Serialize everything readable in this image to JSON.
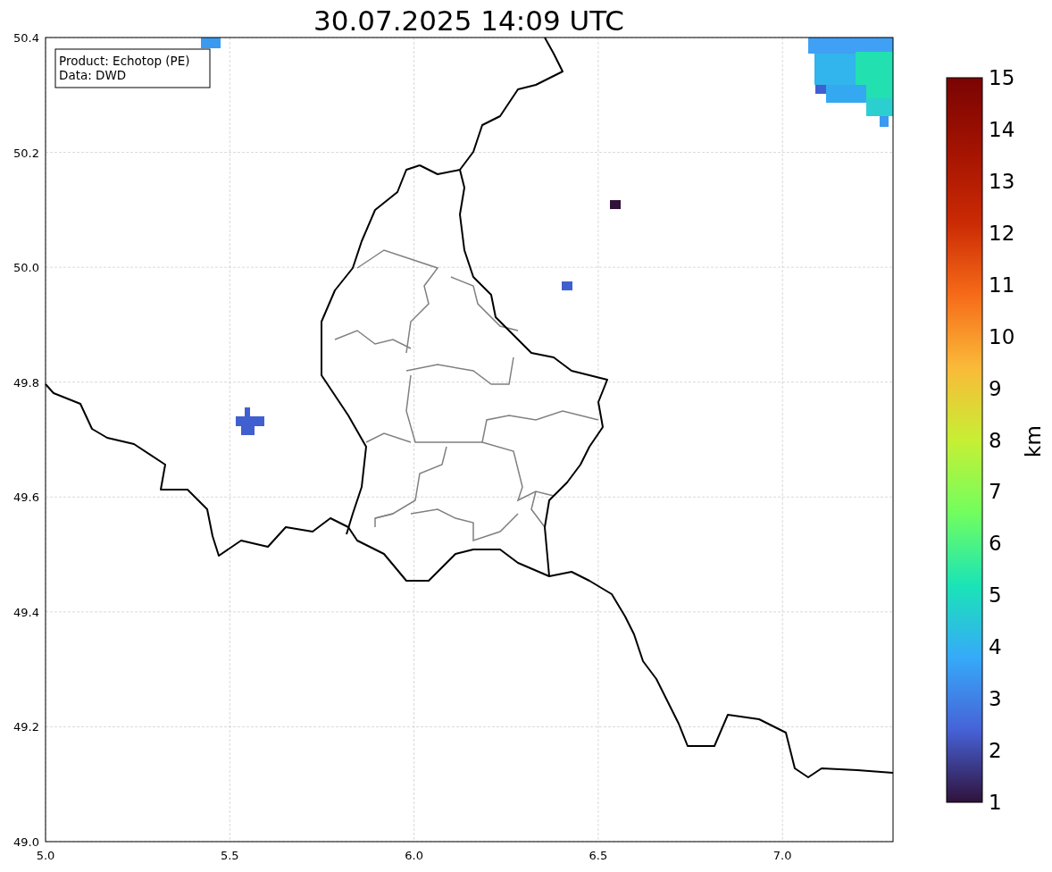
{
  "title": "30.07.2025 14:09 UTC",
  "info_box": [
    "Product: Echotop (PE)",
    "Data: DWD"
  ],
  "x_ticks": [
    "5.0",
    "5.5",
    "6.0",
    "6.5",
    "7.0"
  ],
  "y_ticks": [
    "50.4",
    "50.2",
    "50.0",
    "49.8",
    "49.6",
    "49.4",
    "49.2",
    "49.0"
  ],
  "colorbar": {
    "label": "km",
    "ticks": [
      "15",
      "14",
      "13",
      "12",
      "11",
      "10",
      "9",
      "8",
      "7",
      "6",
      "5",
      "4",
      "3",
      "2",
      "1"
    ]
  }
}
